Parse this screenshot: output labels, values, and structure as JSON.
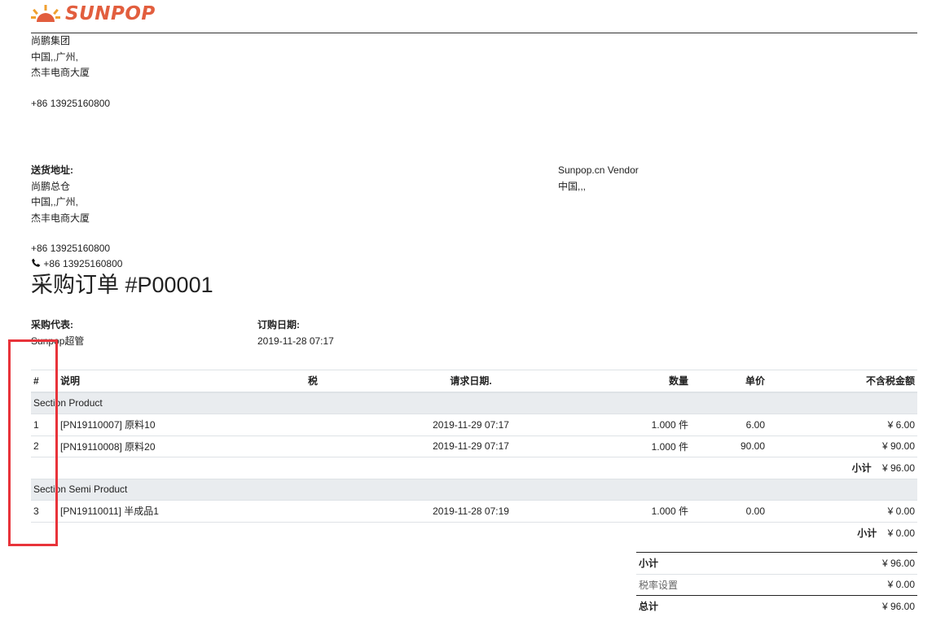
{
  "brand": {
    "name": "SUNPOP",
    "color": "#e25e3e"
  },
  "company": {
    "name": "尚鹏集团",
    "line2": "中国,,广州,",
    "line3": "杰丰电商大厦",
    "phone": "+86 13925160800"
  },
  "shipping": {
    "label": "送货地址:",
    "name": "尚鹏总仓",
    "line2": "中国,,广州,",
    "line3": "杰丰电商大厦",
    "phone": "+86 13925160800",
    "phone_icon": "phone-icon",
    "phone2": "+86 13925160800"
  },
  "vendor": {
    "name": "Sunpop.cn Vendor",
    "address": "中国,,,"
  },
  "title": "采购订单 #P00001",
  "info": {
    "rep_label": "采购代表:",
    "rep_value": "Sunpop超管",
    "date_label": "订购日期:",
    "date_value": "2019-11-28 07:17"
  },
  "table": {
    "headers": [
      "#",
      "说明",
      "税",
      "请求日期.",
      "数量",
      "单价",
      "不含税金额"
    ],
    "section1": "Section Product",
    "rows1": [
      {
        "no": "1",
        "desc": "[PN19110007] 原料10",
        "tax": "",
        "date": "2019-11-29 07:17",
        "qty": "1.000 件",
        "price": "6.00",
        "amount": "¥ 6.00"
      },
      {
        "no": "2",
        "desc": "[PN19110008] 原料20",
        "tax": "",
        "date": "2019-11-29 07:17",
        "qty": "1.000 件",
        "price": "90.00",
        "amount": "¥ 90.00"
      }
    ],
    "subtotal1_label": "小计",
    "subtotal1_value": "¥ 96.00",
    "section2": "Section Semi Product",
    "rows2": [
      {
        "no": "3",
        "desc": "[PN19110011] 半成品1",
        "tax": "",
        "date": "2019-11-28 07:19",
        "qty": "1.000 件",
        "price": "0.00",
        "amount": "¥ 0.00"
      }
    ],
    "subtotal2_label": "小计",
    "subtotal2_value": "¥ 0.00"
  },
  "totals": {
    "subtotal_label": "小计",
    "subtotal_value": "¥ 96.00",
    "tax_label": "税率设置",
    "tax_value": "¥ 0.00",
    "total_label": "总计",
    "total_value": "¥ 96.00"
  },
  "highlight_color": "#e8333a"
}
